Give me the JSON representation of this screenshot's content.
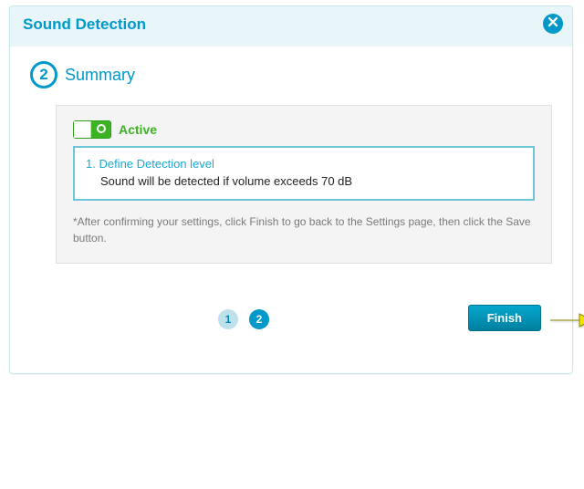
{
  "dialog": {
    "title": "Sound Detection"
  },
  "step": {
    "number": "2",
    "title": "Summary"
  },
  "status": {
    "label": "Active"
  },
  "detail": {
    "title": "1. Define Detection level",
    "text": "Sound will be detected if volume exceeds 70 dB"
  },
  "note": "*After confirming your settings, click Finish to go back to the Settings page, then click the Save button.",
  "pager": {
    "p1": "1",
    "p2": "2"
  },
  "buttons": {
    "finish": "Finish"
  }
}
